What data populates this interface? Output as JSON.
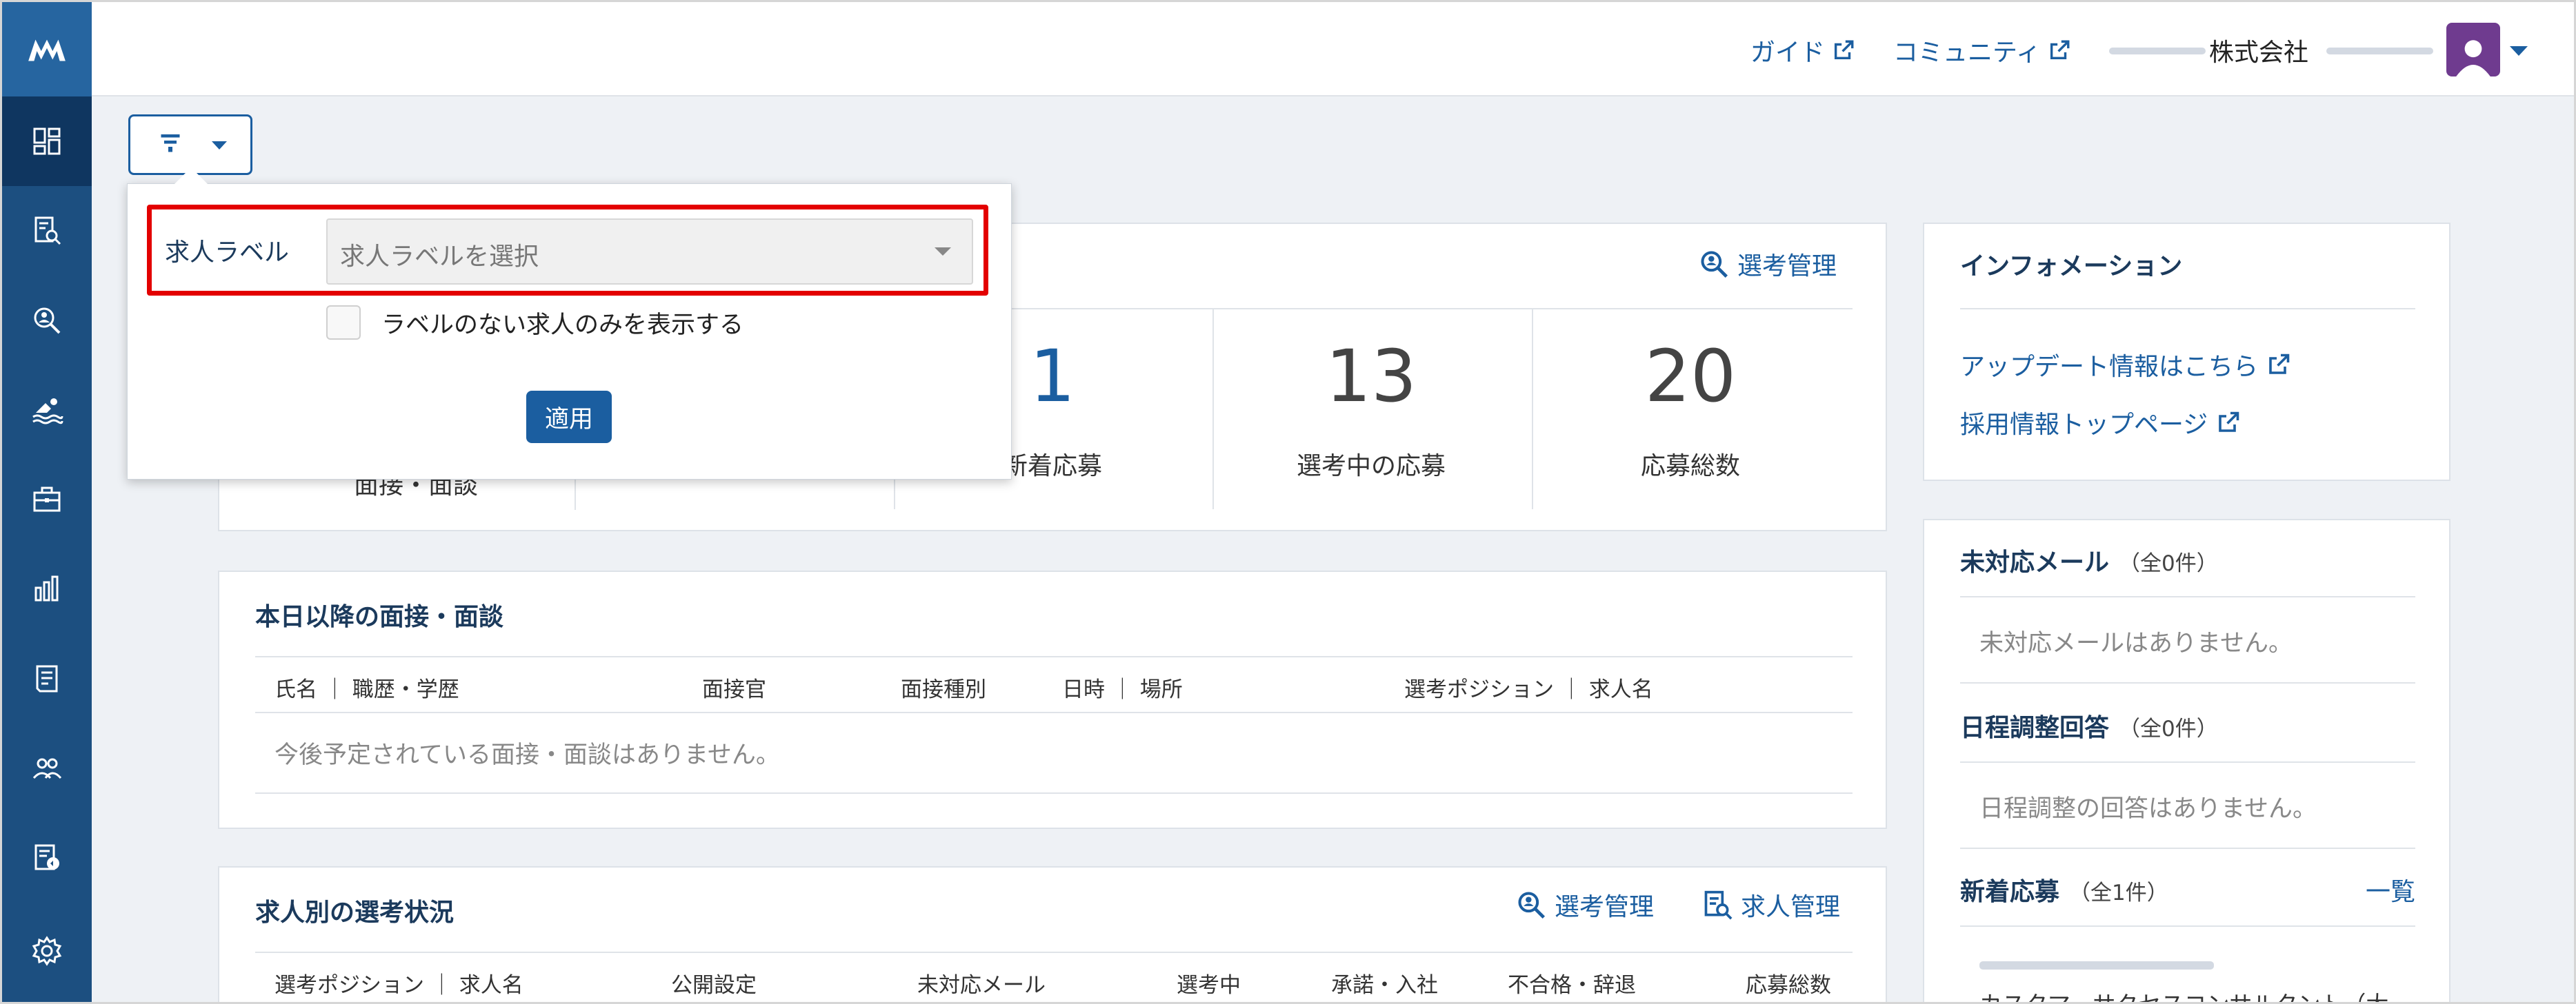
{
  "header": {
    "guide": "ガイド",
    "community": "コミュニティ",
    "company_suffix": "株式会社"
  },
  "sidebar": {
    "items": [
      {
        "icon": "dashboard-icon"
      },
      {
        "icon": "job-search-icon"
      },
      {
        "icon": "candidate-search-icon"
      },
      {
        "icon": "swimmer-icon"
      },
      {
        "icon": "briefcase-icon"
      },
      {
        "icon": "bar-chart-icon"
      },
      {
        "icon": "document-icon"
      },
      {
        "icon": "users-icon"
      },
      {
        "icon": "document-settings-icon"
      },
      {
        "icon": "gear-icon"
      }
    ]
  },
  "filter_popup": {
    "label": "求人ラベル",
    "select_placeholder": "求人ラベルを選択",
    "checkbox_label": "ラベルのない求人のみを表示する",
    "apply": "適用"
  },
  "summary": {
    "selection_link": "選考管理",
    "stats": [
      {
        "value": "1",
        "label": "新着応募"
      },
      {
        "value": "13",
        "label": "選考中の応募"
      },
      {
        "value": "20",
        "label": "応募総数"
      }
    ],
    "hidden_label": "面接・面談"
  },
  "interviews": {
    "title": "本日以降の面接・面談",
    "columns": [
      "氏名 ｜ 職歴・学歴",
      "面接官",
      "面接種別",
      "日時 ｜ 場所",
      "選考ポジション ｜ 求人名"
    ],
    "empty": "今後予定されている面接・面談はありません。"
  },
  "jobs": {
    "title": "求人別の選考状況",
    "link_selection": "選考管理",
    "link_jobs": "求人管理",
    "columns": [
      "選考ポジション ｜ 求人名",
      "公開設定",
      "未対応メール",
      "選考中",
      "承諾・入社",
      "不合格・辞退",
      "応募総数"
    ]
  },
  "info": {
    "title": "インフォメーション",
    "links": [
      "アップデート情報はこちら",
      "採用情報トップページ"
    ]
  },
  "side_lists": {
    "unread_mail": {
      "title": "未対応メール",
      "count": "（全0件）",
      "empty": "未対応メールはありません。"
    },
    "schedule": {
      "title": "日程調整回答",
      "count": "（全0件）",
      "empty": "日程調整の回答はありません。"
    },
    "new_apps": {
      "title": "新着応募",
      "count": "（全1件）",
      "all_link": "一覧",
      "item": "カスタマーサクセスコンサルタント（大"
    }
  }
}
